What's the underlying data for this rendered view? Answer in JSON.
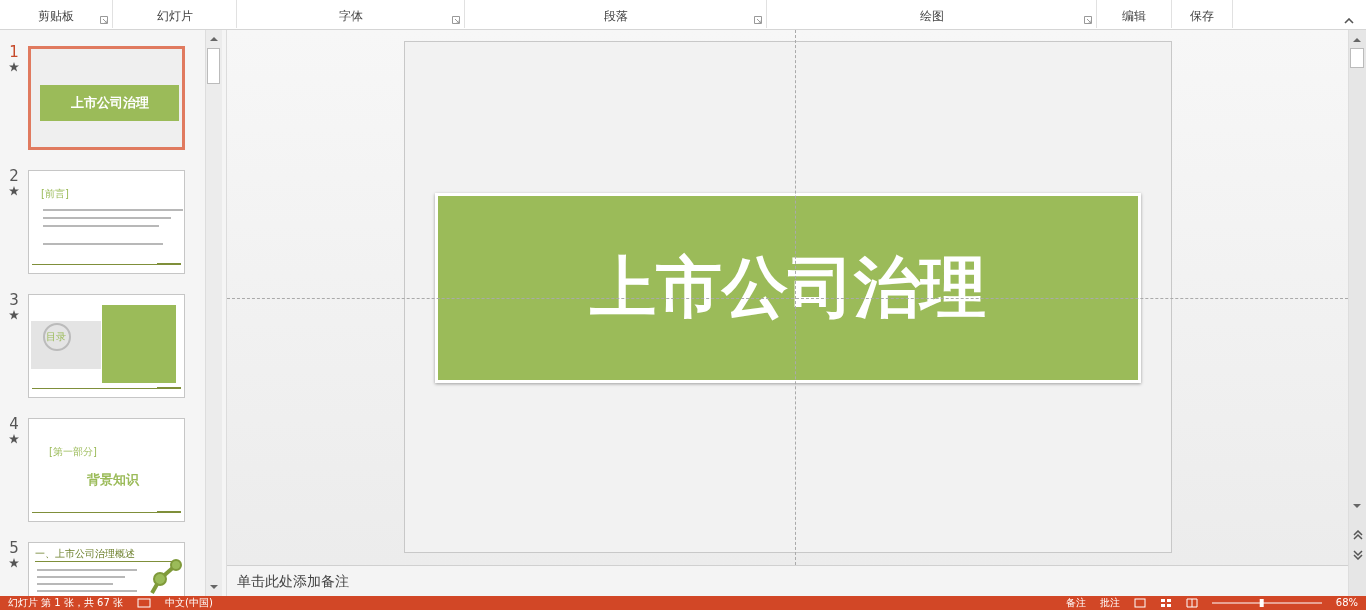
{
  "ribbon": {
    "groups": [
      {
        "label": "剪贴板",
        "launcher": true
      },
      {
        "label": "幻灯片",
        "launcher": false
      },
      {
        "label": "字体",
        "launcher": true
      },
      {
        "label": "段落",
        "launcher": true
      },
      {
        "label": "绘图",
        "launcher": true
      },
      {
        "label": "编辑",
        "launcher": false
      },
      {
        "label": "保存",
        "launcher": false
      }
    ]
  },
  "slides": [
    {
      "number": "1",
      "selected": true,
      "animated": true,
      "kind": "title",
      "title": "上市公司治理"
    },
    {
      "number": "2",
      "selected": false,
      "animated": true,
      "kind": "text",
      "title": "[前言]"
    },
    {
      "number": "3",
      "selected": false,
      "animated": true,
      "kind": "toc",
      "title": "目录"
    },
    {
      "number": "4",
      "selected": false,
      "animated": true,
      "kind": "section",
      "title": "[第一部分]",
      "subtitle": "背景知识"
    },
    {
      "number": "5",
      "selected": false,
      "animated": true,
      "kind": "content",
      "title": "一、上市公司治理概述"
    }
  ],
  "editor": {
    "title": "上市公司治理",
    "notes": {
      "placeholder": "单击此处添加备注"
    }
  },
  "status_bar": {
    "slide_info": "幻灯片 第 1 张，共 67 张",
    "language": "中文(中国)",
    "notes_button": "备注",
    "comments_button": "批注",
    "zoom": "68%",
    "zoom_slider": {
      "level": 0.45
    }
  }
}
